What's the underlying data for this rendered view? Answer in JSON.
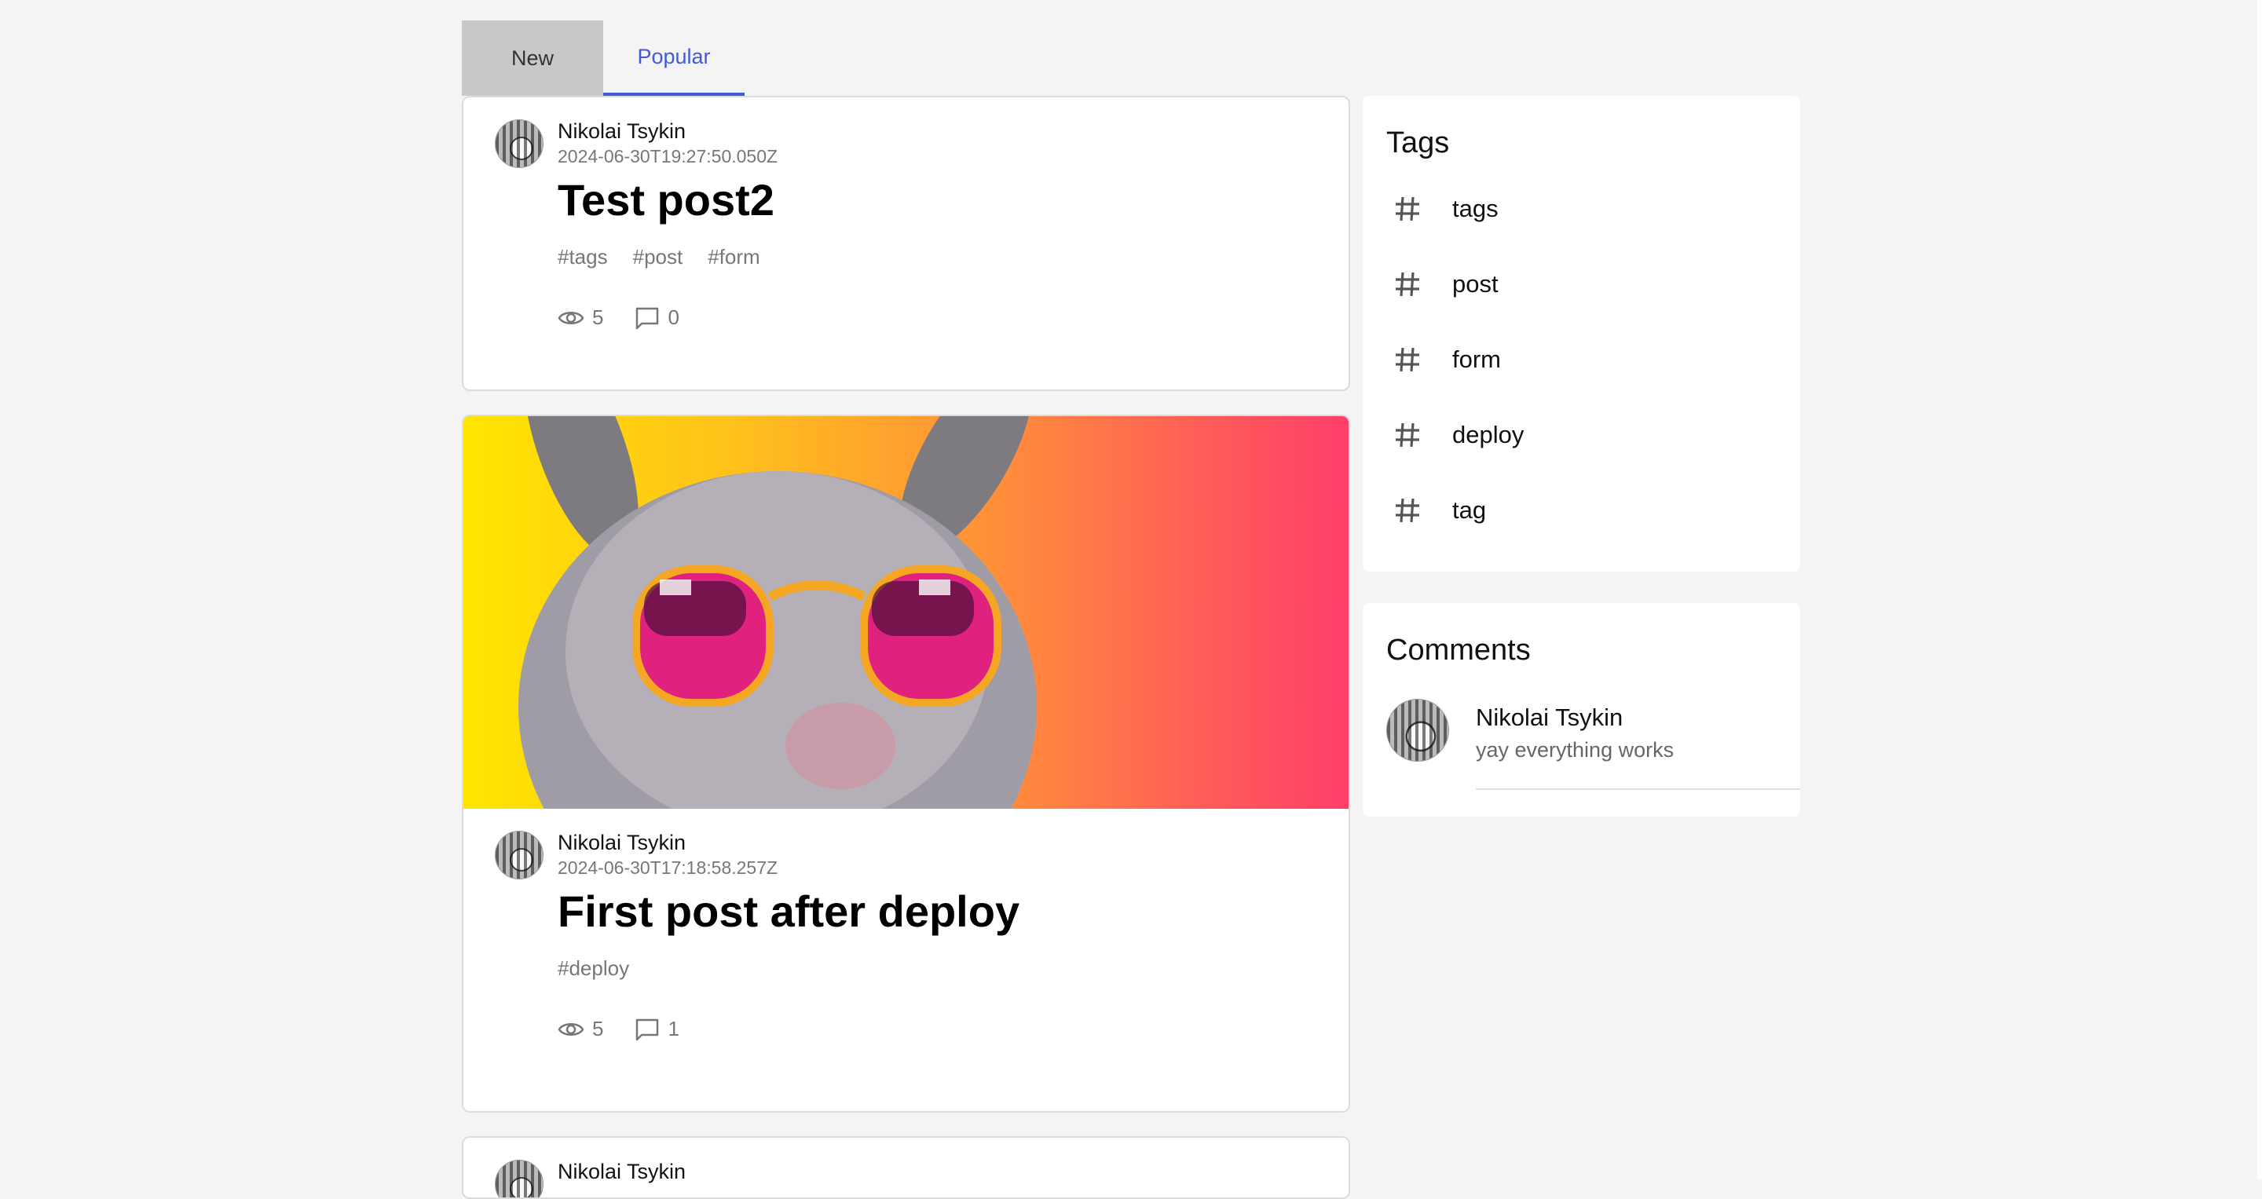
{
  "tabs": {
    "new_label": "New",
    "popular_label": "Popular",
    "active": "Popular"
  },
  "posts": [
    {
      "author": "Nikolai Tsykin",
      "date": "2024-06-30T19:27:50.050Z",
      "title": "Test post2",
      "tags": [
        "#tags",
        "#post",
        "#form"
      ],
      "views": "5",
      "comments": "0",
      "has_image": false
    },
    {
      "author": "Nikolai Tsykin",
      "date": "2024-06-30T17:18:58.257Z",
      "title": "First post after deploy",
      "tags": [
        "#deploy"
      ],
      "views": "5",
      "comments": "1",
      "has_image": true
    },
    {
      "author": "Nikolai Tsykin"
    }
  ],
  "sidebar": {
    "tags_title": "Tags",
    "tags": [
      "tags",
      "post",
      "form",
      "deploy",
      "tag"
    ],
    "comments_title": "Comments",
    "comment": {
      "author": "Nikolai Tsykin",
      "text": "yay everything works"
    }
  },
  "colors": {
    "accent": "#3f5bd8",
    "background": "#f4f4f4",
    "tab_inactive_bg": "#c8c8c8",
    "muted_text": "#777777"
  },
  "icons": {
    "views": "eye-icon",
    "comments": "comment-icon",
    "tag": "hash-icon"
  }
}
